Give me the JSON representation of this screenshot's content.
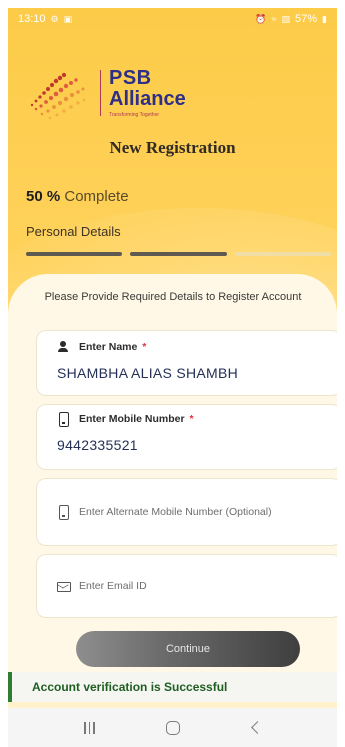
{
  "status_bar": {
    "time": "13:10",
    "battery": "57%",
    "left_icons": [
      "notification-icon",
      "gallery-icon"
    ],
    "right_icons": [
      "alarm-icon",
      "wifi-icon",
      "signal-icon",
      "battery-icon"
    ]
  },
  "brand": {
    "name_line1": "PSB",
    "name_line2": "Alliance",
    "tagline": "Transforming Together",
    "text_color": "#2E2F86",
    "accent_color": "#B33A57"
  },
  "page": {
    "title": "New Registration",
    "progress_percent": "50 %",
    "progress_suffix": "Complete",
    "progress_fraction": 0.5,
    "step_label": "Personal Details",
    "steps": [
      "done",
      "done",
      "todo"
    ]
  },
  "form": {
    "intro": "Please Provide Required Details to Register Account",
    "name": {
      "label": "Enter Name",
      "required_mark": "*",
      "value": "SHAMBHA ALIAS SHAMBH",
      "icon": "person-icon"
    },
    "mobile": {
      "label": "Enter Mobile Number",
      "required_mark": "*",
      "value": "9442335521",
      "icon": "phone-icon"
    },
    "alt_mobile": {
      "placeholder": "Enter Alternate Mobile Number (Optional)",
      "icon": "phone-icon"
    },
    "email": {
      "placeholder": "Enter Email ID",
      "icon": "mail-icon"
    },
    "continue_label": "Continue"
  },
  "toast": {
    "message": "Account verification is Successful",
    "color": "#2F7D32"
  },
  "nav": {
    "buttons": [
      "recent-apps-icon",
      "home-icon",
      "back-icon"
    ]
  },
  "colors": {
    "background": "#FFC83A",
    "card": "#FFF8E6",
    "required": "#E1323A"
  }
}
